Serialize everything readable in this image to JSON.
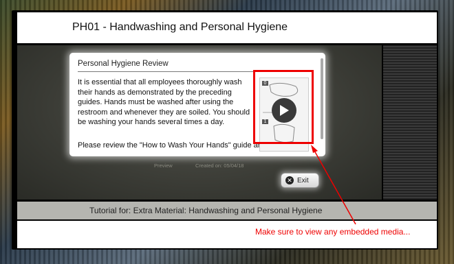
{
  "header": {
    "title": "PH01 - Handwashing and Personal Hygiene"
  },
  "card": {
    "title": "Personal Hygiene Review",
    "paragraph_1": "It is essential that all employees thoroughly wash their hands as demonstrated by the preceding guides. Hands must be washed after using the restroom and whenever they are soiled. You should be washing your hands several times a day.",
    "paragraph_2": "Please review the \"How to Wash Your Hands\" guide and then",
    "media_thumb_numbers": [
      "0",
      "1"
    ]
  },
  "meta": {
    "preview_label": "Preview",
    "created_label": "Created on: 05/04/18"
  },
  "controls": {
    "exit_label": "Exit"
  },
  "footer": {
    "tutorial_text": "Tutorial for: Extra Material: Handwashing and Personal Hygiene"
  },
  "annotation": {
    "callout_text": "Make sure to view any embedded media...",
    "color": "#e00000"
  }
}
